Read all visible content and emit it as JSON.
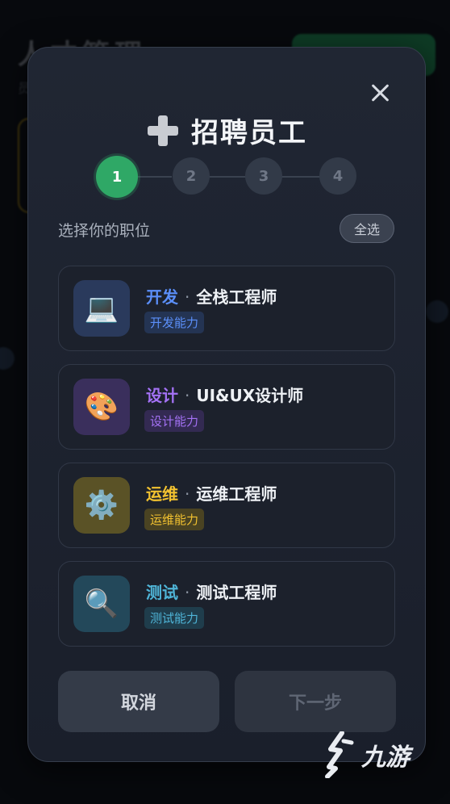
{
  "background": {
    "title": "人才管理",
    "subtitle": "员"
  },
  "modal": {
    "title": "招聘员工",
    "steps": [
      "1",
      "2",
      "3",
      "4"
    ],
    "active_step": 1,
    "section_label": "选择你的职位",
    "select_all_label": "全选",
    "jobs": [
      {
        "category": "开发",
        "role": "全栈工程师",
        "tag": "开发能力",
        "icon": "laptop-icon",
        "glyph": "💻",
        "accent": "#5b8ff9",
        "icon_bg": "#2a3a5c",
        "tag_bg": "#243453",
        "tag_color": "#5b8ff9"
      },
      {
        "category": "设计",
        "role": "UI&UX设计师",
        "tag": "设计能力",
        "icon": "palette-icon",
        "glyph": "🎨",
        "accent": "#a472f5",
        "icon_bg": "#3a2f5c",
        "tag_bg": "#332a52",
        "tag_color": "#a472f5"
      },
      {
        "category": "运维",
        "role": "运维工程师",
        "tag": "运维能力",
        "icon": "gear-icon",
        "glyph": "⚙️",
        "accent": "#f2c230",
        "icon_bg": "#5a5226",
        "tag_bg": "#4a4322",
        "tag_color": "#f2c230"
      },
      {
        "category": "测试",
        "role": "测试工程师",
        "tag": "测试能力",
        "icon": "magnifier-icon",
        "glyph": "🔍",
        "accent": "#4fb5d8",
        "icon_bg": "#23485a",
        "tag_bg": "#1f3d4c",
        "tag_color": "#4fb5d8"
      }
    ],
    "cancel_label": "取消",
    "next_label": "下一步"
  },
  "watermark": {
    "text": "九游"
  }
}
